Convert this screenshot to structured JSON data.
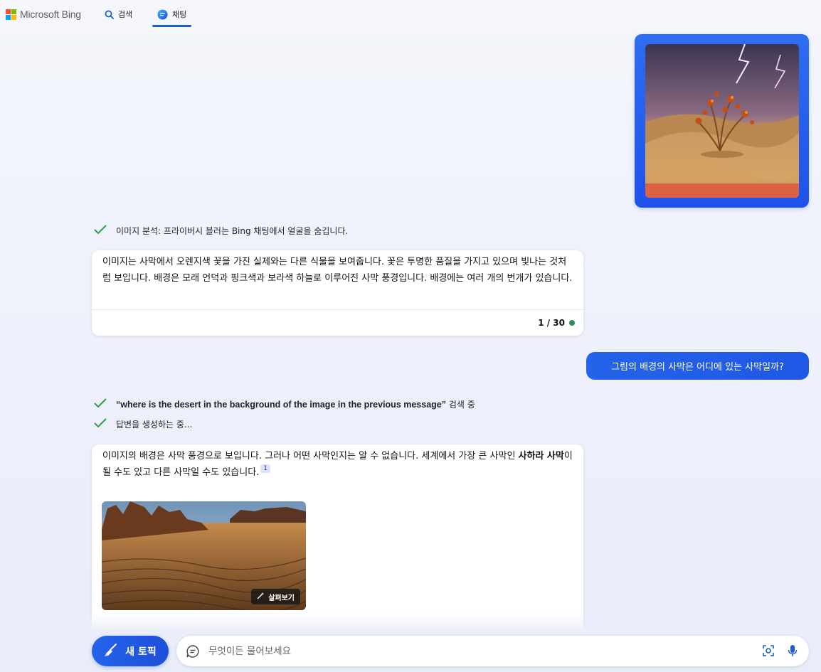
{
  "header": {
    "brand": "Microsoft Bing",
    "tabs": [
      {
        "label": "검색",
        "active": false
      },
      {
        "label": "채팅",
        "active": true
      }
    ],
    "accent": "#1a5fd1"
  },
  "conversation": {
    "status_image_analysis": "이미지 분석: 프라이버시 블러는 Bing 채팅에서 얼굴을 숨깁니다.",
    "bot_reply_1": {
      "text": "이미지는 사막에서 오렌지색 꽃을 가진 실제와는 다른 식물을 보여줍니다. 꽃은 투명한 품질을 가지고 있으며 빛나는 것처럼 보입니다. 배경은 모래 언덕과 핑크색과 보라색 하늘로 이루어진 사막 풍경입니다. 배경에는 여러 개의 번개가 있습니다.",
      "counter": "1 / 30"
    },
    "user_message": "그림의 배경의 사막은 어디에 있는 사막일까?",
    "status_search_query": "“where is the desert in the background of the image in the previous message”",
    "status_search_suffix": "검색 중",
    "status_generating": "답변을 생성하는 중...",
    "bot_reply_2": {
      "text_part1": "이미지의 배경은 사막 풍경으로 보입니다. 그러나 어떤 사막인지는 알 수 없습니다. 세계에서 가장 큰 사막인 ",
      "text_bold": "사하라 사막",
      "text_part2": "이 될 수도 있고 다른 사막일 수도 있습니다.",
      "citation": "1",
      "explore_label": "살펴보기"
    }
  },
  "input_bar": {
    "new_topic_label": "새 토픽",
    "placeholder": "무엇이든 물어보세요"
  },
  "colors": {
    "user_bubble": "#2563eb",
    "check": "#2e9e44",
    "dot": "#2e8b57"
  }
}
